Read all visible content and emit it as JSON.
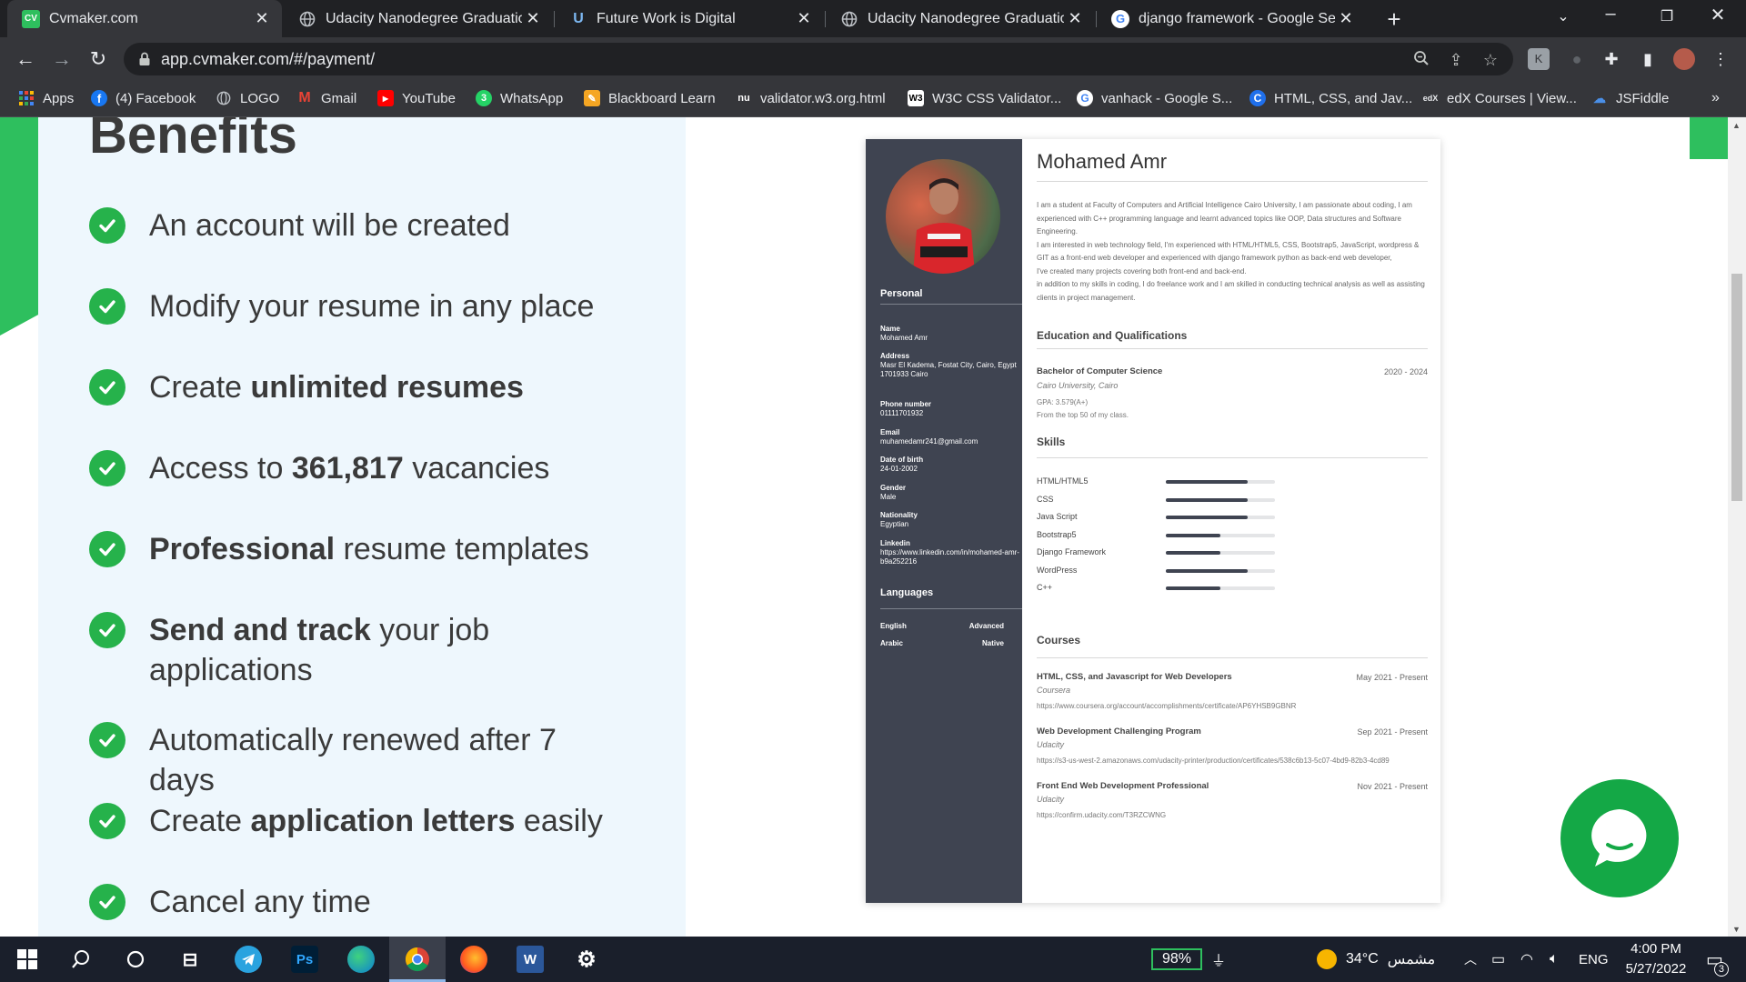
{
  "browser": {
    "tabs": [
      {
        "title": "Cvmaker.com",
        "favicon": "CV"
      },
      {
        "title": "Udacity Nanodegree Graduation",
        "favicon": "globe-icon"
      },
      {
        "title": "Future Work is Digital",
        "favicon": "U"
      },
      {
        "title": "Udacity Nanodegree Graduation",
        "favicon": "globe-icon"
      },
      {
        "title": "django framework - Google Search",
        "favicon": "G"
      }
    ],
    "url": "app.cvmaker.com/#/payment/",
    "bookmarks": [
      "Apps",
      "(4) Facebook",
      "LOGO",
      "Gmail",
      "YouTube",
      "WhatsApp",
      "Blackboard Learn",
      "validator.w3.org.html",
      "W3C CSS Validator...",
      "vanhack - Google S...",
      "HTML, CSS, and Jav...",
      "edX Courses | View...",
      "JSFiddle"
    ],
    "whatsapp_badge": "3"
  },
  "benefits": {
    "title": "Benefits",
    "items": [
      {
        "pre": "An account will be created",
        "bold": "",
        "post": ""
      },
      {
        "pre": "Modify your resume in any place",
        "bold": "",
        "post": ""
      },
      {
        "pre": "Create ",
        "bold": "unlimited resumes",
        "post": ""
      },
      {
        "pre": "Access to ",
        "bold": "361,817",
        "post": " vacancies"
      },
      {
        "pre": "",
        "bold": "Professional",
        "post": " resume templates"
      },
      {
        "pre": "",
        "bold": "Send and track",
        "post": " your job applications"
      },
      {
        "pre": "Automatically renewed after 7 days",
        "bold": "",
        "post": ""
      },
      {
        "pre": "Create ",
        "bold": "application letters",
        "post": " easily"
      },
      {
        "pre": "Cancel any time",
        "bold": "",
        "post": ""
      }
    ]
  },
  "resume": {
    "name": "Mohamed Amr",
    "personal_heading": "Personal",
    "fields": [
      {
        "label": "Name",
        "value": "Mohamed Amr"
      },
      {
        "label": "Address",
        "value": "Masr El Kadema, Fostat City, Cairo, Egypt 1701933 Cairo"
      },
      {
        "label": "Phone number",
        "value": "01111701932"
      },
      {
        "label": "Email",
        "value": "muhamedamr241@gmail.com"
      },
      {
        "label": "Date of birth",
        "value": "24-01-2002"
      },
      {
        "label": "Gender",
        "value": "Male"
      },
      {
        "label": "Nationality",
        "value": "Egyptian"
      },
      {
        "label": "Linkedin",
        "value": "https://www.linkedin.com/in/mohamed-amr-b9a252216"
      }
    ],
    "languages_heading": "Languages",
    "languages": [
      {
        "name": "English",
        "level": "Advanced"
      },
      {
        "name": "Arabic",
        "level": "Native"
      }
    ],
    "about": [
      "I am a student at Faculty of Computers and Artificial Intelligence Cairo University, I am passionate about coding, I am experienced with C++ programming language and learnt advanced topics like OOP, Data structures and Software Engineering.",
      "I am interested in web technology field, I'm experienced with HTML/HTML5, CSS, Bootstrap5, JavaScript, wordpress & GIT as a front-end web developer and experienced with django framework python as back-end web developer,",
      "I've created many projects covering both front-end and back-end.",
      "in addition to my skills in coding, I do freelance work and I am skilled in conducting technical analysis as well as assisting clients in project management."
    ],
    "education_heading": "Education and Qualifications",
    "education": {
      "title": "Bachelor of Computer Science",
      "dates": "2020 - 2024",
      "school": "Cairo University, Cairo",
      "gpa": "GPA: 3.579(A+)",
      "note": "From the top 50 of my class."
    },
    "skills_heading": "Skills",
    "skills": [
      {
        "name": "HTML/HTML5",
        "level": 0.75
      },
      {
        "name": "CSS",
        "level": 0.75
      },
      {
        "name": "Java Script",
        "level": 0.75
      },
      {
        "name": "Bootstrap5",
        "level": 0.5
      },
      {
        "name": "Django Framework",
        "level": 0.5
      },
      {
        "name": "WordPress",
        "level": 0.75
      },
      {
        "name": "C++",
        "level": 0.5
      }
    ],
    "courses_heading": "Courses",
    "courses": [
      {
        "title": "HTML, CSS, and Javascript for Web Developers",
        "dates": "May 2021 - Present",
        "provider": "Coursera",
        "link": "https://www.coursera.org/account/accomplishments/certificate/AP6YHSB9GBNR"
      },
      {
        "title": "Web Development Challenging Program",
        "dates": "Sep 2021 - Present",
        "provider": "Udacity",
        "link": "https://s3-us-west-2.amazonaws.com/udacity-printer/production/certificates/538c6b13-5c07-4bd9-82b3-4cd89"
      },
      {
        "title": "Front End Web Development Professional",
        "dates": "Nov 2021 - Present",
        "provider": "Udacity",
        "link": "https://confirm.udacity.com/T3RZCWNG"
      }
    ]
  },
  "taskbar": {
    "battery": "98%",
    "temperature": "34°C",
    "weather": "مشمس",
    "language": "ENG",
    "time": "4:00 PM",
    "date": "5/27/2022",
    "notifications": "3"
  },
  "colors": {
    "accent_green": "#26b24b",
    "resume_sidebar": "#3f4451",
    "benefits_bg": "#eef7fd"
  }
}
